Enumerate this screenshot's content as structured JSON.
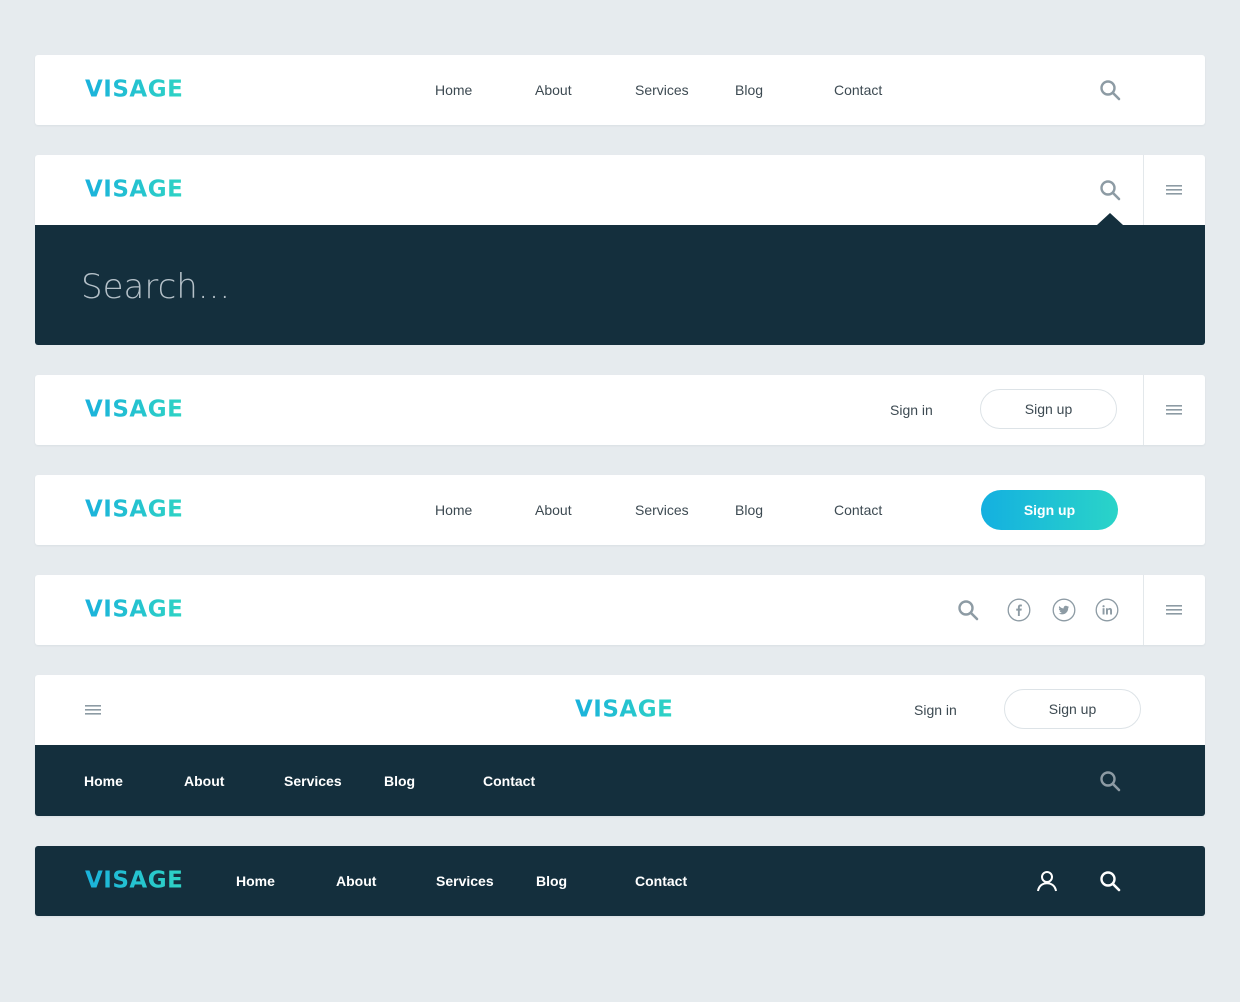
{
  "brand": {
    "logo_text": "VISAGE"
  },
  "colors": {
    "background": "#e6ebee",
    "bar": "#ffffff",
    "dark_bar": "#142f3d",
    "accent_gradient": [
      "#14b0e0",
      "#2ad4c8"
    ],
    "nav_text": "#3d4a52",
    "icon": "#8d9ba4"
  },
  "nav_items": [
    "Home",
    "About",
    "Services",
    "Blog",
    "Contact"
  ],
  "search": {
    "placeholder": "Search..."
  },
  "auth": {
    "sign_in": "Sign in",
    "sign_up": "Sign up"
  },
  "icons": {
    "search": "search-icon",
    "menu": "menu-icon",
    "facebook": "facebook-icon",
    "twitter": "twitter-icon",
    "linkedin": "linkedin-icon",
    "user": "user-icon"
  }
}
